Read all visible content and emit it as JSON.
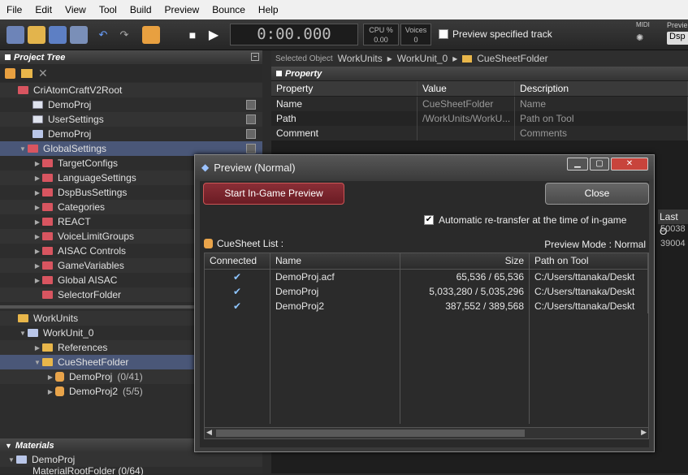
{
  "menu": [
    "File",
    "Edit",
    "View",
    "Tool",
    "Build",
    "Preview",
    "Bounce",
    "Help"
  ],
  "toolbar": {
    "timecode": "0:00.000",
    "cpu_label": "CPU %",
    "cpu_value": "0.00",
    "voices_label": "Voices",
    "voices_value": "0",
    "preview_track": "Preview specified track",
    "midi": "MIDI",
    "preview_cut": "Previe",
    "dsp": "Dsp"
  },
  "project_tree": {
    "title": "Project Tree",
    "rows": [
      {
        "label": "CriAtomCraftV2Root",
        "count": ""
      },
      {
        "label": "DemoProj",
        "count": ""
      },
      {
        "label": "UserSettings",
        "count": ""
      },
      {
        "label": "DemoProj",
        "count": ""
      },
      {
        "label": "GlobalSettings",
        "count": ""
      },
      {
        "label": "TargetConfigs",
        "count": ""
      },
      {
        "label": "LanguageSettings",
        "count": ""
      },
      {
        "label": "DspBusSettings",
        "count": ""
      },
      {
        "label": "Categories",
        "count": ""
      },
      {
        "label": "REACT",
        "count": ""
      },
      {
        "label": "VoiceLimitGroups",
        "count": ""
      },
      {
        "label": "AISAC Controls",
        "count": ""
      },
      {
        "label": "GameVariables",
        "count": ""
      },
      {
        "label": "Global AISAC",
        "count": ""
      },
      {
        "label": "SelectorFolder",
        "count": ""
      },
      {
        "label": "WorkUnits",
        "count": ""
      },
      {
        "label": "WorkUnit_0",
        "count": ""
      },
      {
        "label": "References",
        "count": ""
      },
      {
        "label": "CueSheetFolder",
        "count": ""
      },
      {
        "label": "DemoProj",
        "count": "(0/41)"
      },
      {
        "label": "DemoProj2",
        "count": "(5/5)"
      }
    ]
  },
  "materials": {
    "title": "Materials",
    "root": "DemoProj",
    "child": "MaterialRootFolder (0/64)"
  },
  "selected_object": {
    "label": "Selected Object",
    "path": [
      "WorkUnits",
      "WorkUnit_0",
      "CueSheetFolder"
    ]
  },
  "property": {
    "title": "Property",
    "headers": [
      "Property",
      "Value",
      "Description"
    ],
    "rows": [
      {
        "property": "Name",
        "value": "CueSheetFolder",
        "description": "Name"
      },
      {
        "property": "Path",
        "value": "/WorkUnits/WorkU...",
        "description": "Path on Tool"
      },
      {
        "property": "Comment",
        "value": "",
        "description": "Comments"
      }
    ],
    "right_col_header": "Last O",
    "right_col_values": [
      "50038",
      "39004"
    ]
  },
  "dialog": {
    "title": "Preview (Normal)",
    "start_button": "Start In-Game Preview",
    "close_button": "Close",
    "auto_retransfer": "Automatic re-transfer at the time of in-game",
    "cuesheet_list": "CueSheet List :",
    "preview_mode": "Preview Mode : Normal",
    "table": {
      "headers": [
        "Connected",
        "Name",
        "Size",
        "Path on Tool"
      ],
      "rows": [
        {
          "connected": "✔",
          "name": "DemoProj.acf",
          "size": "65,536 /  65,536",
          "path": "C:/Users/ttanaka/Deskt"
        },
        {
          "connected": "✔",
          "name": "DemoProj",
          "size": "5,033,280 / 5,035,296",
          "path": "C:/Users/ttanaka/Deskt"
        },
        {
          "connected": "✔",
          "name": "DemoProj2",
          "size": "387,552 /  389,568",
          "path": "C:/Users/ttanaka/Deskt"
        }
      ]
    }
  }
}
